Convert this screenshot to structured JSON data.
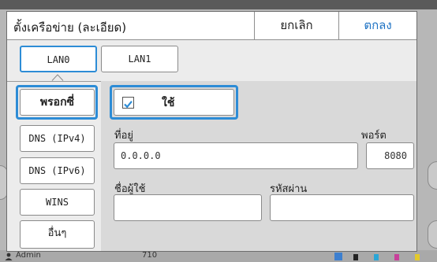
{
  "dialog": {
    "title": "ตั้งเครือข่าย (ละเอียด)",
    "cancel_label": "ยกเลิก",
    "ok_label": "ตกลง"
  },
  "tabs": [
    {
      "label": "LAN0",
      "selected": true
    },
    {
      "label": "LAN1",
      "selected": false
    }
  ],
  "sidebar": {
    "items": [
      {
        "label": "พรอกซี่",
        "selected": true
      },
      {
        "label": "DNS (IPv4)",
        "selected": false
      },
      {
        "label": "DNS (IPv6)",
        "selected": false
      },
      {
        "label": "WINS",
        "selected": false
      },
      {
        "label": "อื่นๆ",
        "selected": false
      }
    ]
  },
  "proxy": {
    "use_label": "ใช้",
    "use_checked": true,
    "address_label": "ที่อยู่",
    "address_value": "0.0.0.0",
    "port_label": "พอร์ต",
    "port_value": "8080",
    "username_label": "ชื่อผู้ใช้",
    "username_value": "",
    "password_label": "รหัสผ่าน",
    "password_value": ""
  },
  "background": {
    "user_label": "Admin",
    "count_label": "710"
  },
  "colors": {
    "accent": "#2d8cd6",
    "ok_text": "#1f73c4"
  }
}
